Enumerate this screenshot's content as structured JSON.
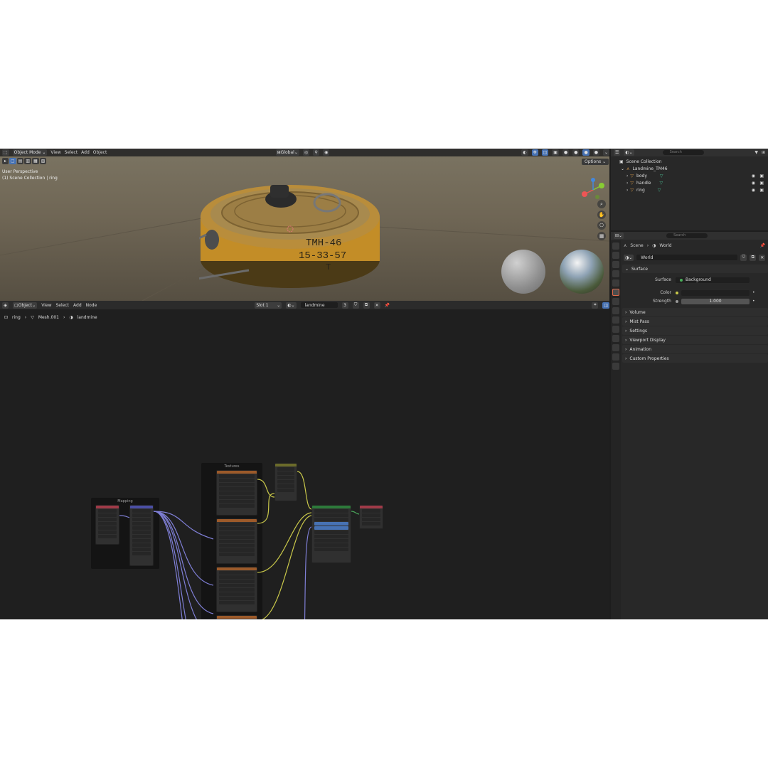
{
  "viewport": {
    "editor_icon": "editor-type-icon",
    "mode": "Object Mode",
    "menu": [
      "View",
      "Select",
      "Add",
      "Object"
    ],
    "transform_orientation": "Global",
    "overlay_title": "User Perspective",
    "overlay_collection": "(1) Scene Collection | ring",
    "options_label": "Options",
    "label_line1": "ТМН-46",
    "label_line2": "15-33-57",
    "label_line3": "Т"
  },
  "node_editor": {
    "object_label": "Object",
    "menu": [
      "View",
      "Select",
      "Add",
      "Node"
    ],
    "slot": "Slot 1",
    "material": "landmine",
    "user_count": "3",
    "breadcrumb": [
      "ring",
      "Mesh.001",
      "landmine"
    ],
    "frame_textures": "Textures",
    "frame_mapping": "Mapping"
  },
  "outliner": {
    "search_placeholder": "Search",
    "root": "Scene Collection",
    "collection": "Landmine_TM46",
    "items": [
      {
        "label": "body"
      },
      {
        "label": "handle"
      },
      {
        "label": "ring"
      }
    ]
  },
  "properties": {
    "search_placeholder": "Search",
    "breadcrumb": [
      "Scene",
      "World"
    ],
    "world_name": "World",
    "section_surface": "Surface",
    "surface_label": "Surface",
    "surface_value": "Background",
    "color_label": "Color",
    "strength_label": "Strength",
    "strength_value": "1.000",
    "sections": [
      "Volume",
      "Mist Pass",
      "Settings",
      "Viewport Display",
      "Animation",
      "Custom Properties"
    ]
  },
  "colors": {
    "accent": "#4772b3",
    "texture_header": "#9c5a2a",
    "shader_header": "#2d7a3a",
    "link_yellow": "#c9c84a",
    "link_purple": "#7f7fd6"
  }
}
